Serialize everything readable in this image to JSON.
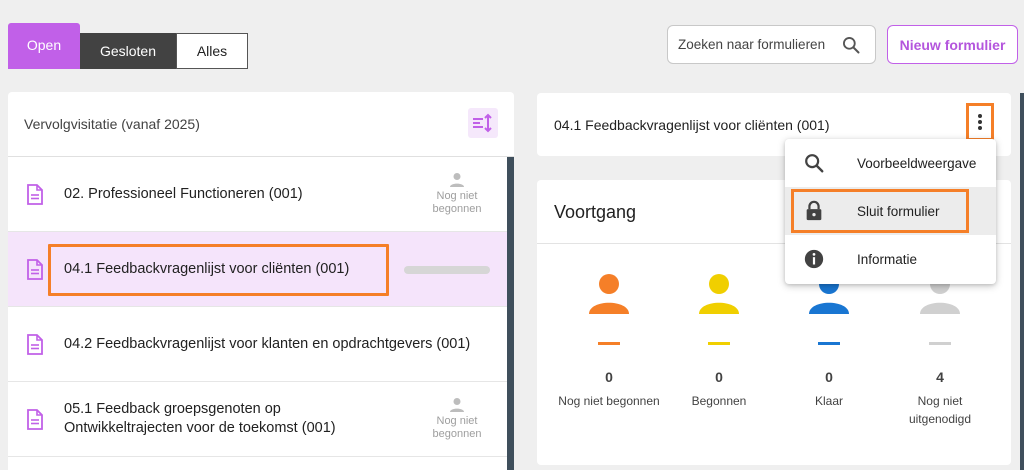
{
  "tabs": {
    "open": "Open",
    "closed": "Gesloten",
    "all": "Alles"
  },
  "search": {
    "placeholder": "Zoeken naar formulieren"
  },
  "header": {
    "new_form": "Nieuw formulier"
  },
  "left_panel": {
    "title": "Vervolgvisitatie (vanaf 2025)",
    "items": [
      {
        "label": "02. Professioneel Functioneren (001)",
        "status_line1": "Nog niet",
        "status_line2": "begonnen"
      },
      {
        "label": "04.1 Feedbackvragenlijst voor cliënten (001)"
      },
      {
        "label": "04.2 Feedbackvragenlijst voor klanten en opdrachtgevers (001)"
      },
      {
        "label_line1": "05.1 Feedback groepsgenoten op",
        "label_line2": "Ontwikkeltrajecten voor de toekomst (001)",
        "status_line1": "Nog niet",
        "status_line2": "begonnen"
      }
    ]
  },
  "form_card": {
    "title": "04.1 Feedbackvragenlijst voor cliënten (001)"
  },
  "menu": {
    "preview": "Voorbeeldweergave",
    "close_form": "Sluit formulier",
    "info": "Informatie"
  },
  "progress": {
    "title": "Voortgang",
    "stats": [
      {
        "value": "0",
        "label_line1": "Nog niet begonnen",
        "color": "#f57f28"
      },
      {
        "value": "0",
        "label_line1": "Begonnen",
        "color": "#f0cf00"
      },
      {
        "value": "0",
        "label_line1": "Klaar",
        "color": "#1976d2"
      },
      {
        "value": "4",
        "label_line1": "Nog niet",
        "label_line2": "uitgenodigd",
        "color": "#d0d0d0"
      }
    ]
  },
  "colors": {
    "accent": "#c160e8",
    "highlight": "#f57f28",
    "dark": "#424242"
  }
}
